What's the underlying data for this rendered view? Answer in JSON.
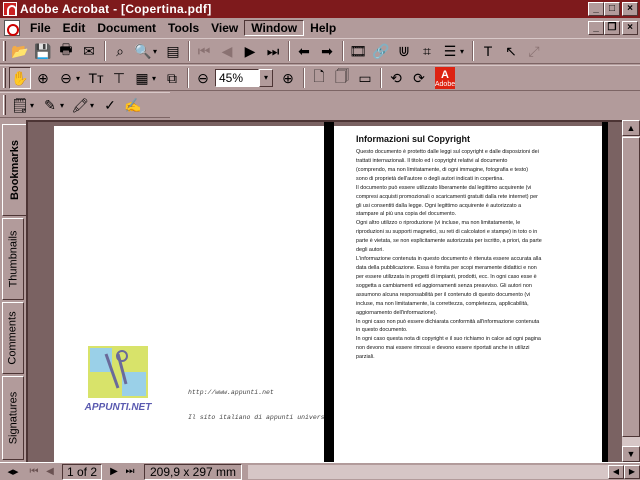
{
  "window": {
    "title": "Adobe Acrobat - [Copertina.pdf]",
    "min": "_",
    "max": "□",
    "close": "×",
    "mdi_min": "_",
    "mdi_restore": "❐",
    "mdi_close": "×"
  },
  "menu": [
    "File",
    "Edit",
    "Document",
    "Tools",
    "View",
    "Window",
    "Help"
  ],
  "toolbar": {
    "zoom_value": "45%",
    "zoom_dd": "▾",
    "adobe": "Adobe"
  },
  "tabs": {
    "bookmarks": "Bookmarks",
    "thumbnails": "Thumbnails",
    "comments": "Comments",
    "signatures": "Signatures"
  },
  "right_page": {
    "title": "Informazioni sul Copyright",
    "lines": [
      "Questo documento è protetto dalle leggi sul copyright e dalle disposizioni dei",
      "trattati internazionali. Il titolo ed i copyright relativi al documento",
      "(comprendo, ma non limitatamente, di ogni immagine, fotografia e testo)",
      "sono di proprietà dell'autore o degli autori indicati in copertina.",
      "Il documento può essere utilizzato liberamente dal legittimo acquirente (vi",
      "compresi acquisti promozionali o scaricamenti gratuiti dalla rete internet) per",
      "gli usi consentiti dalla legge. Ogni legittimo acquirente è autorizzato a",
      "stampare al più una copia del documento.",
      "Ogni altro utilizzo o riproduzione (vi incluse, ma non limitatamente, le",
      "riproduzioni su supporti magnetici, su reti di calcolatori e stampe) in toto o in",
      "parte è vietata, se non esplicitamente autorizzata per iscritto, a priori, da parte",
      "degli autori.",
      "L'informazione contenuta in questo documento è ritenuta essere accurata alla",
      "data della pubblicazione. Essa è fornita per scopi meramente didattici e non",
      "per essere utilizzata in progetti di impianti, prodotti, ecc. In ogni caso esse è",
      "soggetta a cambiamenti ed aggiornamenti senza preavviso. Gli autori non",
      "assumono alcuna responsabilità per il contenuto di questo documento (vi",
      "incluse, ma non limitatamente, la correttezza, completezza, applicabilità,",
      "aggiornamento dell'informazione).",
      "In ogni caso non può essere dichiarata conformità all'informazione contenuta",
      "in questo documento.",
      "In ogni caso questa nota di copyright e il suo richiamo in calce ad ogni pagina",
      "non devono mai essere rimossi e devono essere riportati anche in utilizzi",
      "parziali."
    ]
  },
  "left_page": {
    "url": "http://www.appunti.net",
    "tagline": "Il sito italiano di appunti universitari",
    "logo_text": "APPUNTI.NET"
  },
  "status": {
    "page": "1 of 2",
    "size": "209,9 x 297 mm"
  },
  "colors": {
    "title_bg": "#7e1a1c",
    "chrome": "#b29b9b",
    "doc_bg": "#7a6262"
  }
}
